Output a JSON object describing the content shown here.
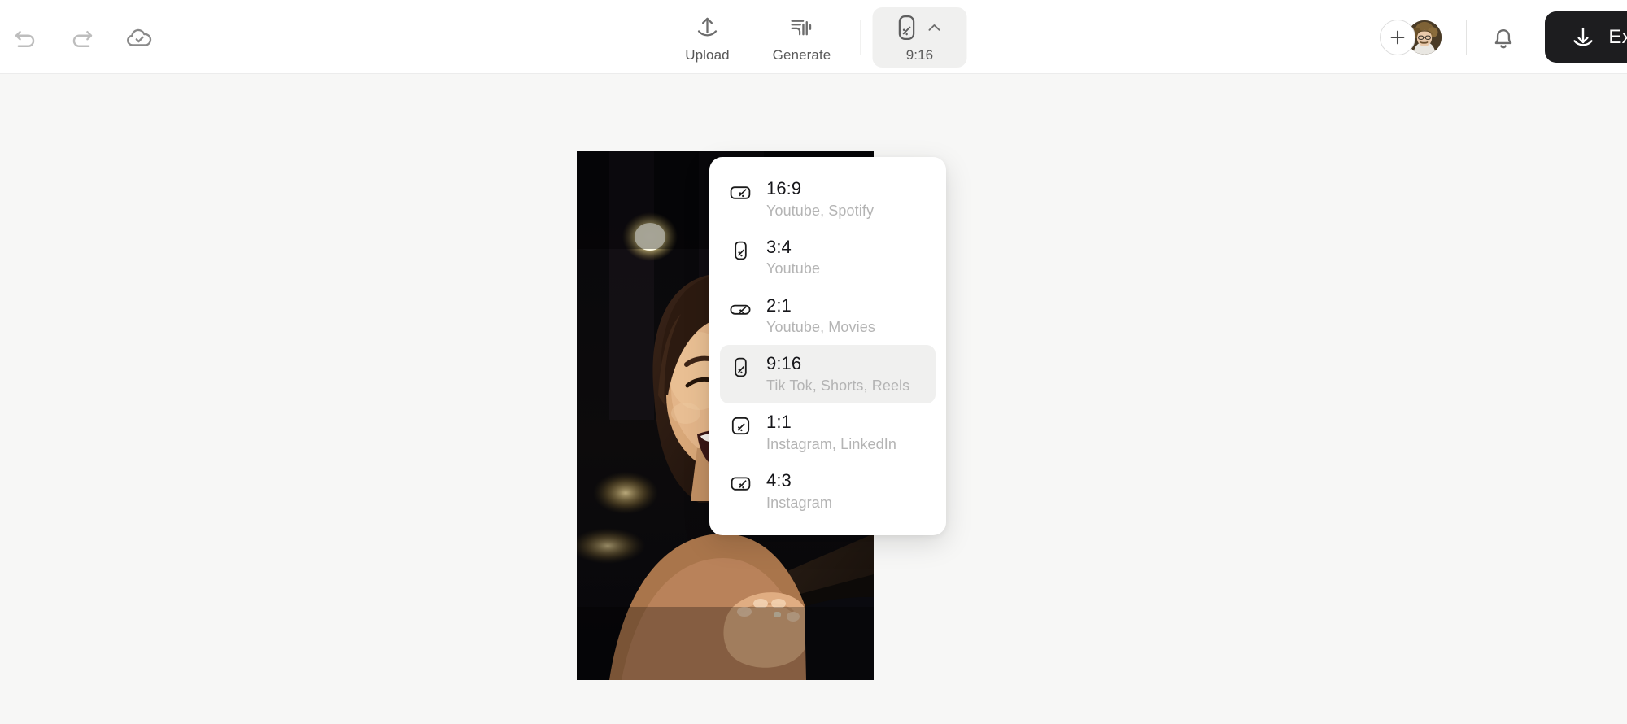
{
  "header": {
    "undo": {
      "label": "Undo",
      "icon": "undo-icon",
      "enabled": false
    },
    "redo": {
      "label": "Redo",
      "icon": "redo-icon",
      "enabled": false
    },
    "save_status": {
      "label": "Saved",
      "icon": "cloud-check-icon"
    },
    "tools": [
      {
        "label": "Upload",
        "icon": "upload-icon"
      },
      {
        "label": "Generate",
        "icon": "generate-icon"
      }
    ],
    "ratio_button": {
      "label": "9:16",
      "icon": "portrait-ratio-icon",
      "chevron": "chevron-up-icon",
      "active": true
    },
    "add_member": {
      "label": "+",
      "icon": "plus-icon"
    },
    "avatar": {
      "name": "user-avatar"
    },
    "notifications": {
      "icon": "bell-icon"
    },
    "export": {
      "label": "Export",
      "icon": "download-icon",
      "color": "#1d1d1f"
    }
  },
  "ratio_menu": {
    "items": [
      {
        "ratio": "16:9",
        "platforms": "Youtube, Spotify",
        "shape": "landscape",
        "selected": false
      },
      {
        "ratio": "3:4",
        "platforms": "Youtube",
        "shape": "portrait",
        "selected": false
      },
      {
        "ratio": "2:1",
        "platforms": "Youtube, Movies",
        "shape": "wide",
        "selected": false
      },
      {
        "ratio": "9:16",
        "platforms": "Tik Tok, Shorts, Reels",
        "shape": "portrait",
        "selected": true
      },
      {
        "ratio": "1:1",
        "platforms": "Instagram, LinkedIn",
        "shape": "square",
        "selected": false
      },
      {
        "ratio": "4:3",
        "platforms": "Instagram",
        "shape": "landscape-narrow",
        "selected": false
      }
    ]
  },
  "canvas": {
    "preview": {
      "name": "video-preview",
      "aspect": "9:16",
      "description": "Woman smiling at night with warm bokeh lights"
    },
    "background_color": "#f7f7f6"
  }
}
